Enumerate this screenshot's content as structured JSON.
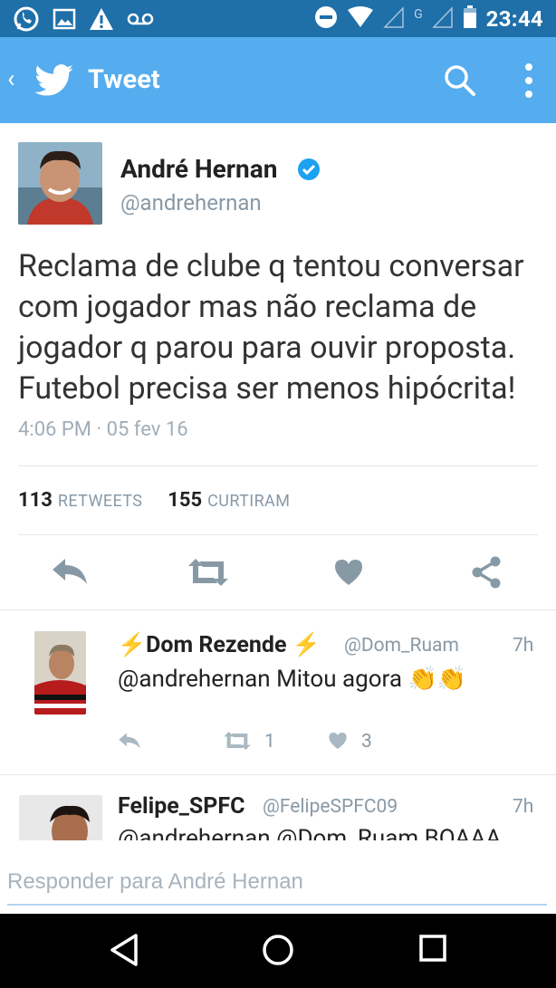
{
  "status_bar": {
    "time": "23:44",
    "network_label": "G"
  },
  "app_bar": {
    "title": "Tweet"
  },
  "tweet": {
    "author_name": "André Hernan",
    "author_handle": "@andrehernan",
    "text": "Reclama de clube q tentou conversar com jogador mas não reclama de jogador q parou para ouvir proposta. Futebol precisa ser menos hipócrita!",
    "timestamp": "4:06 PM · 05 fev 16",
    "retweets_count": "113",
    "retweets_label": "RETWEETS",
    "likes_count": "155",
    "likes_label": "CURTIRAM"
  },
  "replies": [
    {
      "name": "⚡Dom Rezende ⚡",
      "handle": "@Dom_Ruam",
      "time": "7h",
      "text": "@andrehernan Mitou agora 👏👏",
      "retweets": "1",
      "likes": "3"
    },
    {
      "name": "Felipe_SPFC",
      "handle": "@FelipeSPFC09",
      "time": "7h",
      "text": "@andrehernan @Dom_Ruam BOAAA"
    }
  ],
  "composer": {
    "placeholder": "Responder para André Hernan"
  },
  "colors": {
    "status_bar": "#1f6fa8",
    "app_bar": "#55acee",
    "action_icon": "#8899a6",
    "verified": "#1da1f2"
  }
}
